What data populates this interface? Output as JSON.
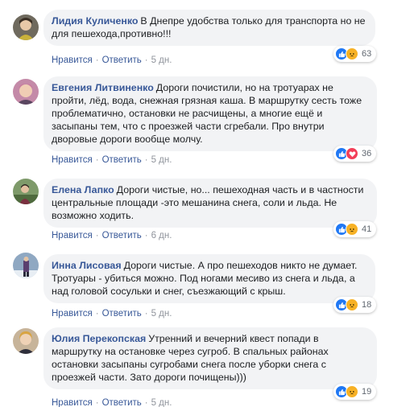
{
  "comments": [
    {
      "author": "Лидия Куличенко",
      "text": "В Днепре удобства только для транспорта но не для пешехода,противно!!!",
      "like_label": "Нравится",
      "reply_label": "Ответить",
      "time": "5 дн.",
      "reaction_count": "63",
      "reactions": [
        "like-icon",
        "angry-icon"
      ]
    },
    {
      "author": "Евгения Литвиненко",
      "text": "Дороги почистили, но на тротуарах не пройти, лёд, вода, снежная грязная каша. В маршрутку сесть тоже проблематично, остановки не расчищены, а многие ещё и засыпаны тем, что с проезжей части сгребали. Про внутри дворовые дороги вообще молчу.",
      "like_label": "Нравится",
      "reply_label": "Ответить",
      "time": "5 дн.",
      "reaction_count": "36",
      "reactions": [
        "like-icon",
        "love-icon"
      ]
    },
    {
      "author": "Елена Лапко",
      "text": "Дороги чистые, но... пешеходная часть и в частности центральные площади -это мешанина снега, соли и льда. Не возможно ходить.",
      "like_label": "Нравится",
      "reply_label": "Ответить",
      "time": "6 дн.",
      "reaction_count": "41",
      "reactions": [
        "like-icon",
        "angry-icon"
      ]
    },
    {
      "author": "Инна Лисовая",
      "text": "Дороги чистые. А про пешеходов никто не думает. Тротуары - убиться можно. Под ногами месиво из снега и льда, а над головой сосульки и снег, съезжающий с крыш.",
      "like_label": "Нравится",
      "reply_label": "Ответить",
      "time": "5 дн.",
      "reaction_count": "18",
      "reactions": [
        "like-icon",
        "angry-icon"
      ]
    },
    {
      "author": "Юлия Перекопская",
      "text": "Утренний и вечерний квест попади в маршрутку на остановке через сугроб. В спальных районах остановки засыпаны сугробами снега после уборки снега с проезжей части. Зато дороги почищены)))",
      "like_label": "Нравится",
      "reply_label": "Ответить",
      "time": "5 дн.",
      "reaction_count": "19",
      "reactions": [
        "like-icon",
        "angry-icon"
      ]
    }
  ],
  "colors": {
    "author": "#385898",
    "bubble": "#f2f3f5",
    "like": "#2078f4",
    "angry": "#f7b125",
    "love": "#f33e58"
  }
}
